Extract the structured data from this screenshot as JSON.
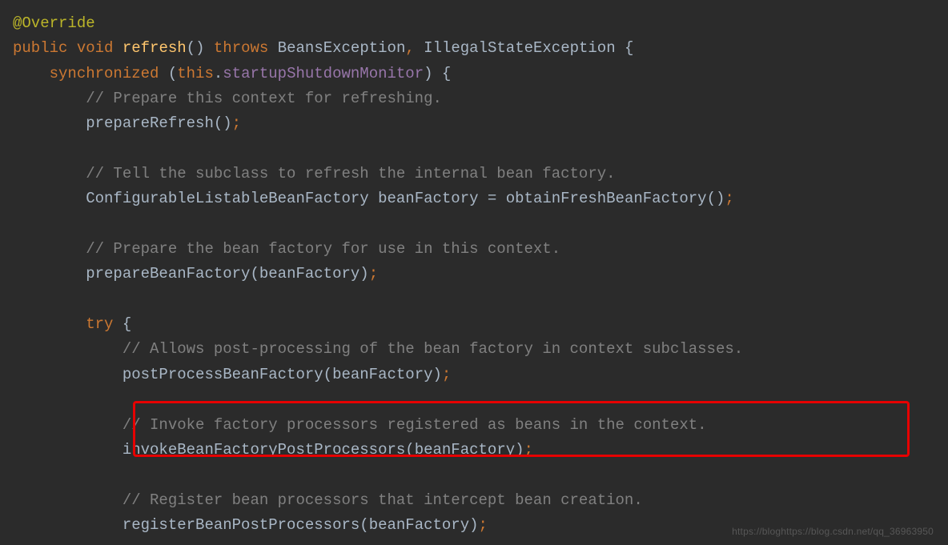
{
  "code": {
    "line1": {
      "annotation": "@Override"
    },
    "line2": {
      "kw_public": "public",
      "kw_void": "void",
      "method": "refresh",
      "parens": "()",
      "kw_throws": "throws",
      "exc1": "BeansException",
      "comma": ",",
      "exc2": "IllegalStateException",
      "brace": "{"
    },
    "line3": {
      "kw_sync": "synchronized",
      "lparen": "(",
      "kw_this": "this",
      "dot": ".",
      "field": "startupShutdownMonitor",
      "rparen": ")",
      "brace": "{"
    },
    "line4": {
      "comment": "// Prepare this context for refreshing."
    },
    "line5": {
      "method": "prepareRefresh",
      "parens": "()",
      "semi": ";"
    },
    "line7": {
      "comment": "// Tell the subclass to refresh the internal bean factory."
    },
    "line8": {
      "type": "ConfigurableListableBeanFactory",
      "var": "beanFactory",
      "eq": "=",
      "method": "obtainFreshBeanFactory",
      "parens": "()",
      "semi": ";"
    },
    "line10": {
      "comment": "// Prepare the bean factory for use in this context."
    },
    "line11": {
      "method": "prepareBeanFactory",
      "lparen": "(",
      "arg": "beanFactory",
      "rparen": ")",
      "semi": ";"
    },
    "line13": {
      "kw_try": "try",
      "brace": "{"
    },
    "line14": {
      "comment": "// Allows post-processing of the bean factory in context subclasses."
    },
    "line15": {
      "method": "postProcessBeanFactory",
      "lparen": "(",
      "arg": "beanFactory",
      "rparen": ")",
      "semi": ";"
    },
    "line17": {
      "comment": "// Invoke factory processors registered as beans in the context."
    },
    "line18": {
      "method": "invokeBeanFactoryPostProcessors",
      "lparen": "(",
      "arg": "beanFactory",
      "rparen": ")",
      "semi": ";"
    },
    "line20": {
      "comment": "// Register bean processors that intercept bean creation."
    },
    "line21": {
      "method": "registerBeanPostProcessors",
      "lparen": "(",
      "arg": "beanFactory",
      "rparen": ")",
      "semi": ";"
    }
  },
  "indent": {
    "i1": "    ",
    "i2": "        ",
    "i3": "            "
  },
  "watermark": "https://bloghttps://blog.csdn.net/qq_36963950"
}
